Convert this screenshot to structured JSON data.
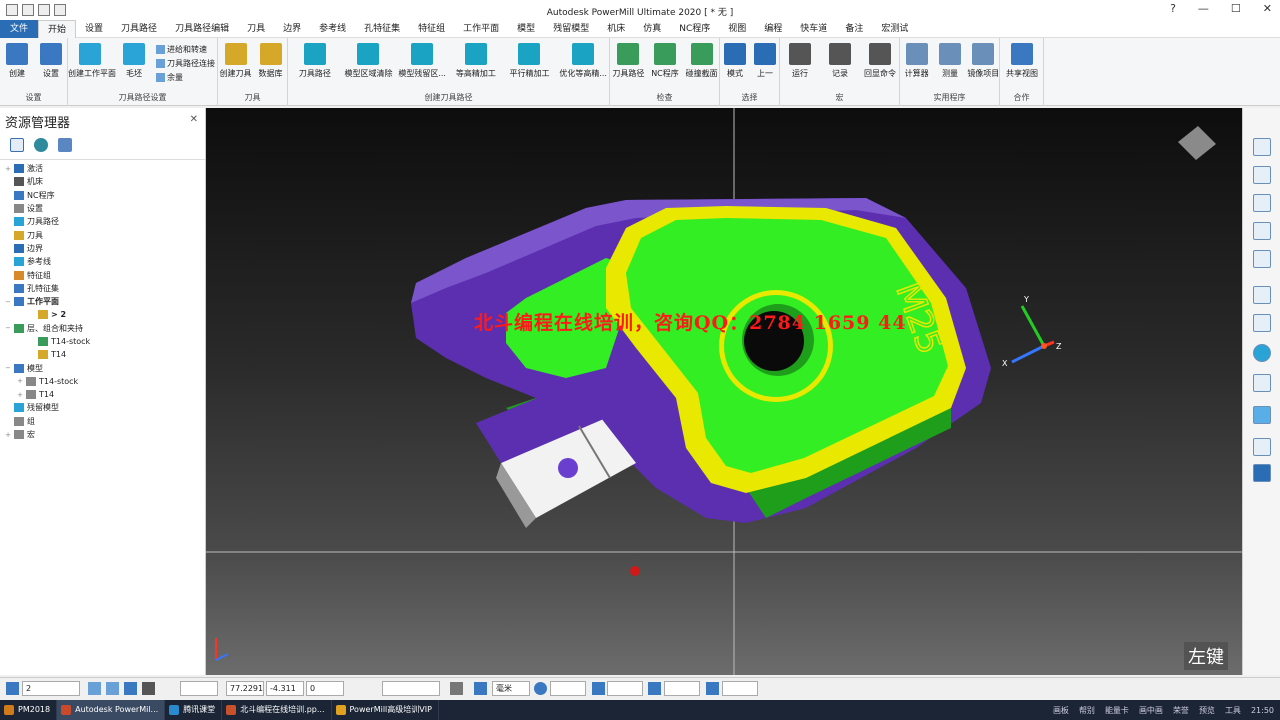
{
  "window": {
    "title": "Autodesk PowerMill Ultimate 2020  [ * 无 ]",
    "help_icon": "help-icon",
    "controls": [
      "minimize-icon",
      "maximize-icon",
      "close-icon"
    ]
  },
  "menu": [
    "文件",
    "开始",
    "设置",
    "刀具路径",
    "刀具路径编辑",
    "刀具",
    "边界",
    "参考线",
    "孔特征集",
    "特征组",
    "工作平面",
    "模型",
    "残留模型",
    "机床",
    "仿真",
    "NC程序",
    "视图",
    "编程",
    "快车道",
    "备注",
    "宏测试"
  ],
  "ribbon": {
    "groups": [
      {
        "label": "设置",
        "buttons": [
          "创建",
          "设置"
        ]
      },
      {
        "label": "刀具路径设置",
        "buttons": [
          "创建工作平面",
          "毛坯"
        ],
        "small": [
          "进给和转速",
          "刀具路径连接",
          "余量"
        ]
      },
      {
        "label": "刀具",
        "buttons": [
          "创建刀具",
          "数据库"
        ]
      },
      {
        "label": "创建刀具路径",
        "buttons": [
          "刀具路径",
          "模型区域清除",
          "模型残留区...",
          "等高精加工",
          "平行精加工",
          "优化等高精..."
        ]
      },
      {
        "label": "检查",
        "buttons": [
          "刀具路径",
          "NC程序",
          "碰撞截面"
        ]
      },
      {
        "label": "选择",
        "buttons": [
          "模式",
          "上一"
        ]
      },
      {
        "label": "宏",
        "buttons": [
          "运行",
          "记录",
          "回显命令"
        ]
      },
      {
        "label": "实用程序",
        "buttons": [
          "计算器",
          "测量",
          "镜像项目"
        ]
      },
      {
        "label": "合作",
        "buttons": [
          "共享视图"
        ]
      }
    ]
  },
  "explorer": {
    "title": "资源管理器",
    "tree": [
      {
        "label": "激活",
        "depth": 0,
        "toggle": "+"
      },
      {
        "label": "机床",
        "depth": 0,
        "toggle": ""
      },
      {
        "label": "NC程序",
        "depth": 0,
        "toggle": ""
      },
      {
        "label": "设置",
        "depth": 0,
        "toggle": ""
      },
      {
        "label": "刀具路径",
        "depth": 0,
        "toggle": ""
      },
      {
        "label": "刀具",
        "depth": 0,
        "toggle": ""
      },
      {
        "label": "边界",
        "depth": 0,
        "toggle": ""
      },
      {
        "label": "参考线",
        "depth": 0,
        "toggle": ""
      },
      {
        "label": "特征组",
        "depth": 0,
        "toggle": ""
      },
      {
        "label": "孔特征集",
        "depth": 0,
        "toggle": ""
      },
      {
        "label": "工作平面",
        "depth": 0,
        "toggle": "−"
      },
      {
        "label": "> 2",
        "depth": 2,
        "toggle": ""
      },
      {
        "label": "层、组合和夹持",
        "depth": 0,
        "toggle": "−"
      },
      {
        "label": "T14-stock",
        "depth": 2,
        "toggle": ""
      },
      {
        "label": "T14",
        "depth": 2,
        "toggle": ""
      },
      {
        "label": "模型",
        "depth": 0,
        "toggle": "−"
      },
      {
        "label": "T14-stock",
        "depth": 1,
        "toggle": "+"
      },
      {
        "label": "T14",
        "depth": 1,
        "toggle": "+"
      },
      {
        "label": "残留模型",
        "depth": 0,
        "toggle": ""
      },
      {
        "label": "组",
        "depth": 0,
        "toggle": ""
      },
      {
        "label": "宏",
        "depth": 0,
        "toggle": "+"
      }
    ]
  },
  "viewport": {
    "watermark": "北斗编程在线培训，咨询QQ：2784 1659 44",
    "part_label": "M25",
    "hint1": "左键",
    "hint2": "左键",
    "axis": {
      "x": "X",
      "y": "Y",
      "z": "Z"
    }
  },
  "status": {
    "workplane": "2",
    "x": "77.2291",
    "y": "-4.311",
    "z": "0",
    "units": "毫米"
  },
  "taskbar": {
    "items": [
      "PM2018",
      "Autodesk PowerMil...",
      "腾讯课堂",
      "北斗编程在线培训.pp...",
      "PowerMill高级培训VIP"
    ],
    "tray": [
      "画板",
      "帮别",
      "能量卡",
      "画中画",
      "荣誉",
      "预览",
      "工具"
    ],
    "clock": "21:50"
  },
  "colors": {
    "accent": "#2a6db5",
    "part_green": "#33ee22",
    "part_purple": "#5b2fb0",
    "part_yellow": "#e8e800"
  }
}
